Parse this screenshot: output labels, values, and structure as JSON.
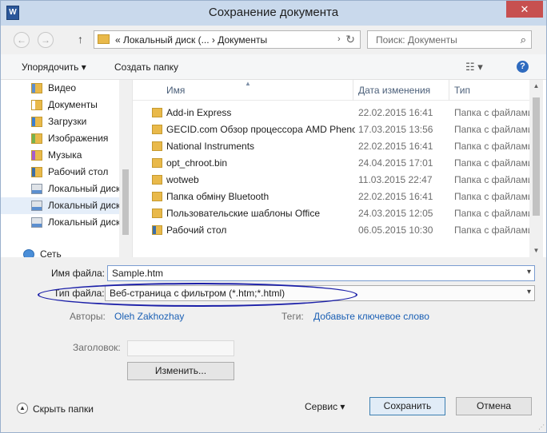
{
  "window": {
    "title": "Сохранение документа",
    "app_icon": "word-icon",
    "app_letter": "W",
    "close_glyph": "✕"
  },
  "nav": {
    "address": "«  Локальный диск (...  ›  Документы",
    "address_chevron": "›",
    "search_placeholder": "Поиск: Документы",
    "back_glyph": "←",
    "forward_glyph": "→",
    "up_glyph": "↑",
    "refresh_glyph": "↻",
    "search_glyph": "⌕"
  },
  "toolbar": {
    "arrange": "Упорядочить ▾",
    "new_folder": "Создать папку",
    "view_glyph": "☷ ▾",
    "help_glyph": "?"
  },
  "navpane": {
    "items": [
      {
        "label": "Видео",
        "icon": "video-folder-icon"
      },
      {
        "label": "Документы",
        "icon": "documents-folder-icon"
      },
      {
        "label": "Загрузки",
        "icon": "downloads-folder-icon"
      },
      {
        "label": "Изображения",
        "icon": "pictures-folder-icon"
      },
      {
        "label": "Музыка",
        "icon": "music-folder-icon"
      },
      {
        "label": "Рабочий стол",
        "icon": "desktop-folder-icon"
      },
      {
        "label": "Локальный диск",
        "icon": "disk-icon"
      },
      {
        "label": "Локальный диск",
        "icon": "disk-icon"
      },
      {
        "label": "Локальный диск",
        "icon": "disk-icon"
      },
      {
        "label": "Сеть",
        "icon": "network-icon"
      }
    ]
  },
  "filelist": {
    "columns": {
      "name": "Имя",
      "date": "Дата изменения",
      "type": "Тип"
    },
    "sort_glyph": "▲",
    "rows": [
      {
        "name": "Add-in Express",
        "date": "22.02.2015 16:41",
        "type": "Папка с файлами"
      },
      {
        "name": "GECID.com  Обзор процессора AMD Phenom",
        "date": "17.03.2015 13:56",
        "type": "Папка с файлами"
      },
      {
        "name": "National Instruments",
        "date": "22.02.2015 16:41",
        "type": "Папка с файлами"
      },
      {
        "name": "opt_chroot.bin",
        "date": "24.04.2015 17:01",
        "type": "Папка с файлами"
      },
      {
        "name": "wotweb",
        "date": "11.03.2015 22:47",
        "type": "Папка с файлами"
      },
      {
        "name": "Папка обміну Bluetooth",
        "date": "22.02.2015 16:41",
        "type": "Папка с файлами"
      },
      {
        "name": "Пользовательские шаблоны Office",
        "date": "24.03.2015 12:05",
        "type": "Папка с файлами"
      },
      {
        "name": "Рабочий стол",
        "date": "06.05.2015 10:30",
        "type": "Папка с файлами"
      }
    ],
    "scroll_up_glyph": "▲",
    "scroll_down_glyph": "▼"
  },
  "form": {
    "filename_label": "Имя файла:",
    "filename_value": "Sample.htm",
    "filetype_label": "Тип файла:",
    "filetype_value": "Веб-страница с фильтром (*.htm;*.html)",
    "dropdown_glyph": "▾",
    "authors_label": "Авторы:",
    "authors_value": "Oleh Zakhozhay",
    "tags_label": "Теги:",
    "tags_value": "Добавьте ключевое слово",
    "title_label": "Заголовок:",
    "change_button": "Изменить...",
    "hide_folders": "Скрыть папки",
    "hide_glyph": "▲",
    "tools_button": "Сервис  ▾",
    "save_button": "Сохранить",
    "cancel_button": "Отмена"
  }
}
